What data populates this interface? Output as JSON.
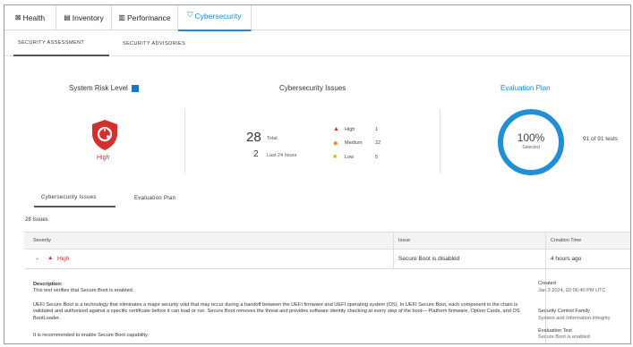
{
  "tabs": [
    {
      "label": "Health",
      "icon": "health-icon",
      "glyph": "⊠"
    },
    {
      "label": "Inventory",
      "icon": "inventory-icon",
      "glyph": "▤"
    },
    {
      "label": "Performance",
      "icon": "performance-icon",
      "glyph": "▥"
    },
    {
      "label": "Cybersecurity",
      "icon": "shield-icon",
      "glyph": "⛉"
    }
  ],
  "subtabs": [
    "Security Assessment",
    "Security Advisories"
  ],
  "risk": {
    "title": "System Risk Level",
    "level": "High"
  },
  "issues_summary": {
    "title": "Cybersecurity Issues",
    "total": "28",
    "total_label": "Total",
    "recent": "2",
    "recent_label": "Last 24 hours",
    "severities": [
      {
        "label": "High",
        "count": "1",
        "color": "#d32f2f",
        "glyph": "▲"
      },
      {
        "label": "Medium",
        "count": "22",
        "color": "#f08c1a",
        "glyph": "◆"
      },
      {
        "label": "Low",
        "count": "5",
        "color": "#f5b400",
        "glyph": "■"
      }
    ]
  },
  "evaluation": {
    "title": "Evaluation Plan",
    "percent": "100%",
    "percent_label": "Selected",
    "tests": "91 of 91 tests"
  },
  "lower_tabs": [
    "Cybersecurity Issues",
    "Evaluation Plan"
  ],
  "issues_count": "28 Issues",
  "table": {
    "headers": [
      "Severity",
      "Issue",
      "Creation Time"
    ],
    "row": {
      "severity": "High",
      "issue": "Secure Boot is disabled",
      "time": "4 hours ago"
    }
  },
  "detail": {
    "description_label": "Description:",
    "description": "This test verifies that Secure Boot is enabled.",
    "body": "UEFI Secure Boot is a technology that eliminates a major security void that may occur during a handoff between the UEFI firmware and UEFI operating system (OS). In UEFI Secure Boot, each component in the chain is validated and authorized against a specific certificate before it can load or run. Secure Boot removes the threat and provides software identity checking at every step of the boot— Platform firmware, Option Cards, and OS BootLoader.",
    "recommendation": "It is recommended to enable Secure Boot capability.",
    "created_label": "Created",
    "created_value": "Jan 3 2024, 02:06:40 PM UTC",
    "family_label": "Security Control Family",
    "family_value": "System and Information Integrity",
    "test_label": "Evaluation Test",
    "test_value": "Secure Boot is enabled"
  },
  "colors": {
    "accent": "#1a8cd8",
    "high": "#d32f2f",
    "donut": "#1f8fd6"
  }
}
